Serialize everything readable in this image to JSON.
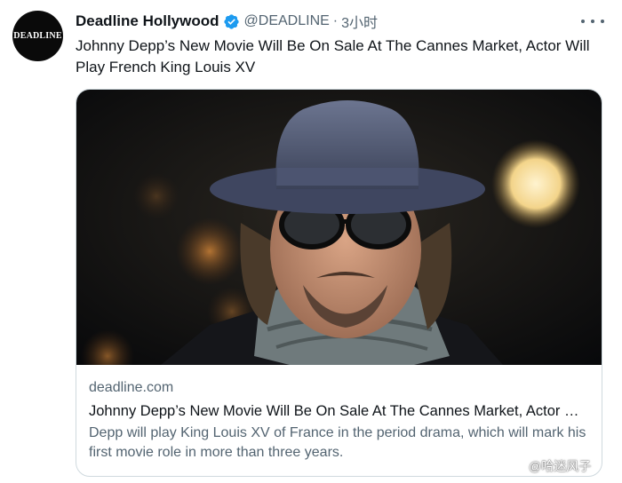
{
  "account": {
    "avatar_text": "DEADLINE",
    "display_name": "Deadline Hollywood",
    "handle": "@DEADLINE",
    "separator": "·",
    "time": "3小时",
    "verified_color": "#1d9bf0"
  },
  "tweet": {
    "text": "Johnny Depp’s New Movie Will Be On Sale At The Cannes Market, Actor Will Play French King Louis XV"
  },
  "card": {
    "domain": "deadline.com",
    "title": "Johnny Depp’s New Movie Will Be On Sale At The Cannes Market, Actor Will Play French King Louis XV",
    "description": "Depp will play King Louis XV of France in the period drama, which will mark his first movie role in more than three years."
  },
  "watermark": {
    "text": "@哈迷风子",
    "icon": "weibo-logo-icon"
  },
  "icons": {
    "verified": "verified-badge-icon",
    "more": "more-options-icon"
  }
}
